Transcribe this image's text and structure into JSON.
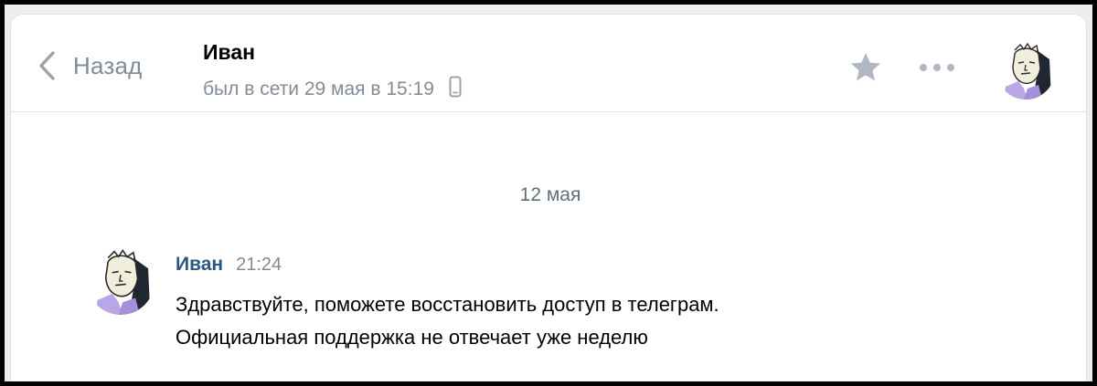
{
  "header": {
    "back_label": "Назад",
    "peer_name": "Иван",
    "peer_status": "был в сети 29 мая в 15:19",
    "status_device_icon": "mobile-phone-icon",
    "favorite_icon": "star-icon",
    "more_icon": "more-dots-icon"
  },
  "conversation": {
    "date_separator": "12 мая",
    "messages": [
      {
        "author": "Иван",
        "time": "21:24",
        "lines": [
          "Здравствуйте, поможете восстановить доступ в телеграм.",
          "Официальная поддержка не отвечает уже неделю"
        ]
      }
    ]
  },
  "colors": {
    "accent_link": "#2a5885",
    "secondary_text": "#818c99",
    "icon_gray": "#aeb7c2"
  }
}
